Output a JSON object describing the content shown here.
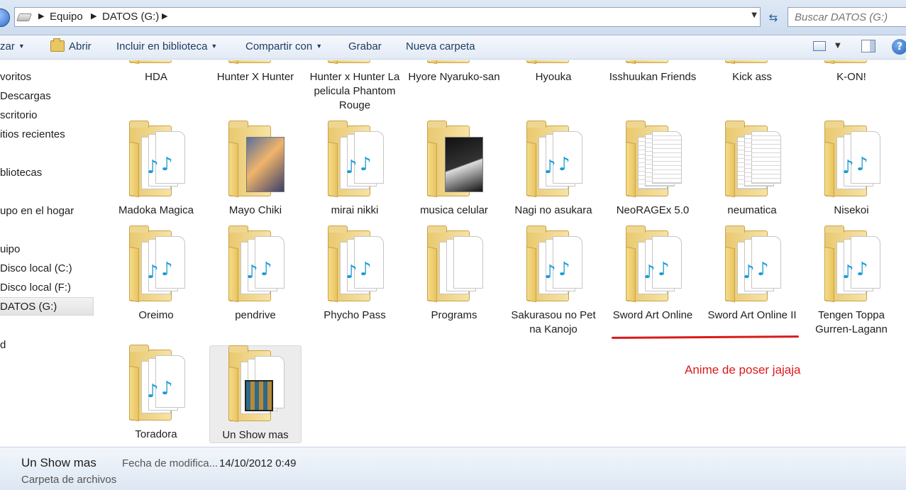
{
  "address": {
    "crumbs": [
      "Equipo",
      "DATOS (G:)"
    ],
    "search_placeholder": "Buscar DATOS (G:)"
  },
  "toolbar": {
    "organize": "zar",
    "open": "Abrir",
    "include": "Incluir en biblioteca",
    "share": "Compartir con",
    "burn": "Grabar",
    "new_folder": "Nueva carpeta"
  },
  "sidebar": {
    "items": [
      {
        "label": "voritos"
      },
      {
        "label": "Descargas"
      },
      {
        "label": "scritorio"
      },
      {
        "label": "itios recientes"
      },
      {
        "label": "bliotecas"
      },
      {
        "label": "upo en el hogar"
      },
      {
        "label": "uipo"
      },
      {
        "label": "Disco local (C:)"
      },
      {
        "label": "Disco local (F:)"
      },
      {
        "label": "DATOS (G:)",
        "selected": true
      },
      {
        "label": "d"
      }
    ]
  },
  "folders": [
    {
      "label": "HDA",
      "kind": "music"
    },
    {
      "label": "Hunter X Hunter",
      "kind": "music"
    },
    {
      "label": "Hunter x Hunter La pelicula Phantom Rouge",
      "kind": "music"
    },
    {
      "label": "Hyore Nyaruko-san",
      "kind": "music"
    },
    {
      "label": "Hyouka",
      "kind": "music"
    },
    {
      "label": "Isshuukan Friends",
      "kind": "music"
    },
    {
      "label": "Kick ass",
      "kind": "music"
    },
    {
      "label": "K-ON!",
      "kind": "music"
    },
    {
      "label": "Madoka Magica",
      "kind": "music"
    },
    {
      "label": "Mayo Chiki",
      "kind": "picture"
    },
    {
      "label": "mirai nikki",
      "kind": "music"
    },
    {
      "label": "musica celular",
      "kind": "album"
    },
    {
      "label": "Nagi no asukara",
      "kind": "music"
    },
    {
      "label": "NeoRAGEx 5.0",
      "kind": "document"
    },
    {
      "label": "neumatica",
      "kind": "document"
    },
    {
      "label": "Nisekoi",
      "kind": "music"
    },
    {
      "label": "Oreimo",
      "kind": "music"
    },
    {
      "label": "pendrive",
      "kind": "music"
    },
    {
      "label": "Phycho Pass",
      "kind": "music"
    },
    {
      "label": "Programs",
      "kind": "blank"
    },
    {
      "label": "Sakurasou no Pet na Kanojo",
      "kind": "music"
    },
    {
      "label": "Sword Art Online",
      "kind": "music"
    },
    {
      "label": "Sword Art Online II",
      "kind": "music"
    },
    {
      "label": "Tengen Toppa Gurren-Lagann",
      "kind": "music"
    },
    {
      "label": "Toradora",
      "kind": "music"
    },
    {
      "label": "Un Show mas",
      "kind": "video",
      "selected": true
    }
  ],
  "status": {
    "name": "Un Show mas",
    "type": "Carpeta de archivos",
    "modified_label": "Fecha de modifica...",
    "modified_value": "14/10/2012 0:49"
  },
  "annotation": {
    "text": "Anime de poser jajaja",
    "color": "#d91a1a"
  },
  "colors": {
    "folder": "#e9c970",
    "note": "#1a9bd3",
    "toolbar_text": "#1e3a5f"
  }
}
